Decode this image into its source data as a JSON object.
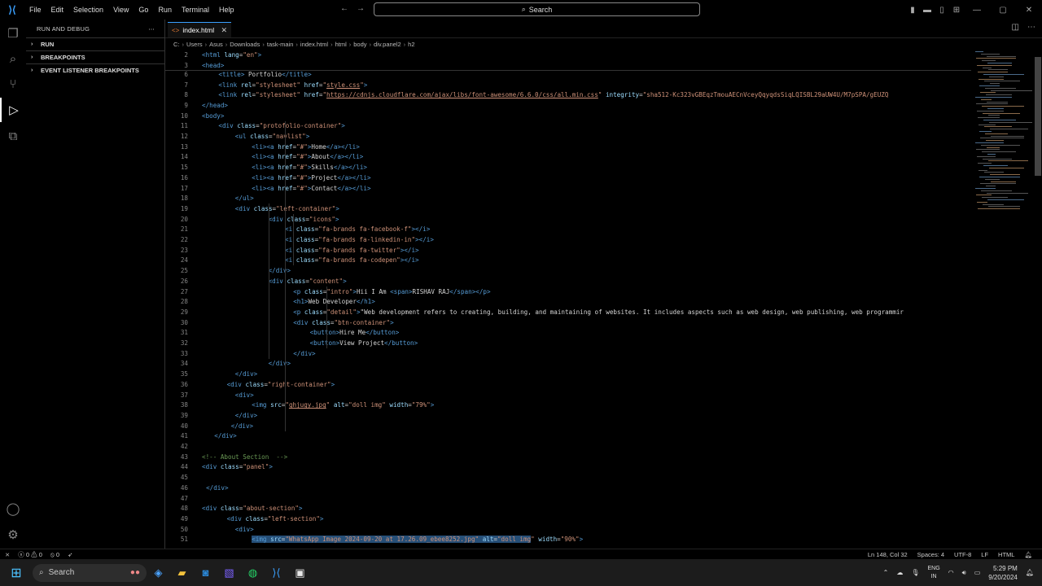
{
  "menu": [
    "File",
    "Edit",
    "Selection",
    "View",
    "Go",
    "Run",
    "Terminal",
    "Help"
  ],
  "command_center": {
    "label": "Search"
  },
  "tab": {
    "filename": "index.html"
  },
  "sidebar": {
    "title": "RUN AND DEBUG",
    "sections": [
      "RUN",
      "BREAKPOINTS",
      "EVENT LISTENER BREAKPOINTS"
    ]
  },
  "breadcrumb": [
    "C:",
    "Users",
    "Asus",
    "Downloads",
    "task-main",
    "index.html",
    "html",
    "body",
    "div.panel2",
    "h2"
  ],
  "sticky_lines": [
    {
      "n": "2",
      "html": "<span class='tag'>&lt;html</span> <span class='attr'>lang</span>=<span class='str'>\"en\"</span><span class='tag'>&gt;</span>"
    },
    {
      "n": "3",
      "html": "<span class='tag'>&lt;head&gt;</span>"
    }
  ],
  "code_lines": [
    {
      "n": "6",
      "i": 1,
      "html": "<span class='tag'>&lt;title&gt;</span> Portfolio<span class='tag'>&lt;/title&gt;</span>"
    },
    {
      "n": "7",
      "i": 1,
      "html": "<span class='tag'>&lt;link</span> <span class='attr'>rel</span>=<span class='str'>\"stylesheet\"</span> <span class='attr'>href</span>=<span class='str'>\"<u>style.css</u>\"</span><span class='tag'>&gt;</span>"
    },
    {
      "n": "8",
      "i": 1,
      "html": "<span class='tag'>&lt;link</span> <span class='attr'>rel</span>=<span class='str'>\"stylesheet\"</span> <span class='attr'>href</span>=<span class='str'>\"<u>https://cdnjs.cloudflare.com/ajax/libs/font-awesome/6.6.0/css/all.min.css</u>\"</span> <span class='attr'>integrity</span>=<span class='str'>\"sha512-Kc323vGBEqzTmouAECnVceyQqyqdsSiqLQISBL29aUW4U/M7pSPA/gEUZQ</span>"
    },
    {
      "n": "9",
      "i": 0,
      "html": "<span class='tag'>&lt;/head&gt;</span>"
    },
    {
      "n": "10",
      "i": 0,
      "html": "<span class='tag'>&lt;body&gt;</span>"
    },
    {
      "n": "11",
      "i": 1,
      "html": "<span class='tag'>&lt;div</span> <span class='attr'>class</span>=<span class='str'>\"protofolio-container\"</span><span class='tag'>&gt;</span>"
    },
    {
      "n": "12",
      "i": 2,
      "html": "<span class='tag'>&lt;ul</span> <span class='attr'>class</span>=<span class='str'>\"navlist\"</span><span class='tag'>&gt;</span>"
    },
    {
      "n": "13",
      "i": 3,
      "html": "<span class='tag'>&lt;li&gt;&lt;a</span> <span class='attr'>href</span>=<span class='str'>\"#\"</span><span class='tag'>&gt;</span>Home<span class='tag'>&lt;/a&gt;&lt;/li&gt;</span>"
    },
    {
      "n": "14",
      "i": 3,
      "html": "<span class='tag'>&lt;li&gt;&lt;a</span> <span class='attr'>href</span>=<span class='str'>\"#\"</span><span class='tag'>&gt;</span>About<span class='tag'>&lt;/a&gt;&lt;/li&gt;</span>"
    },
    {
      "n": "15",
      "i": 3,
      "html": "<span class='tag'>&lt;li&gt;&lt;a</span> <span class='attr'>href</span>=<span class='str'>\"#\"</span><span class='tag'>&gt;</span>Skills<span class='tag'>&lt;/a&gt;&lt;/li&gt;</span>"
    },
    {
      "n": "16",
      "i": 3,
      "html": "<span class='tag'>&lt;li&gt;&lt;a</span> <span class='attr'>href</span>=<span class='str'>\"#\"</span><span class='tag'>&gt;</span>Project<span class='tag'>&lt;/a&gt;&lt;/li&gt;</span>"
    },
    {
      "n": "17",
      "i": 3,
      "html": "<span class='tag'>&lt;li&gt;&lt;a</span> <span class='attr'>href</span>=<span class='str'>\"#\"</span><span class='tag'>&gt;</span>Contact<span class='tag'>&lt;/a&gt;&lt;/li&gt;</span>"
    },
    {
      "n": "18",
      "i": 2,
      "html": "<span class='tag'>&lt;/ul&gt;</span>"
    },
    {
      "n": "19",
      "i": 2,
      "html": "<span class='tag'>&lt;div</span> <span class='attr'>class</span>=<span class='str'>\"left-container\"</span><span class='tag'>&gt;</span>"
    },
    {
      "n": "20",
      "i": 4,
      "html": "<span class='tag'>&lt;div</span> <span class='attr'>class</span>=<span class='str'>\"icons\"</span><span class='tag'>&gt;</span>"
    },
    {
      "n": "21",
      "i": 5,
      "html": "<span class='tag'>&lt;i</span> <span class='attr'>class</span>=<span class='str'>\"fa-brands fa-facebook-f\"</span><span class='tag'>&gt;&lt;/i&gt;</span>"
    },
    {
      "n": "22",
      "i": 5,
      "html": "<span class='tag'>&lt;i</span> <span class='attr'>class</span>=<span class='str'>\"fa-brands fa-linkedin-in\"</span><span class='tag'>&gt;&lt;/i&gt;</span>"
    },
    {
      "n": "23",
      "i": 5,
      "html": "<span class='tag'>&lt;i</span> <span class='attr'>class</span>=<span class='str'>\"fa-brands fa-twitter\"</span><span class='tag'>&gt;&lt;/i&gt;</span>"
    },
    {
      "n": "24",
      "i": 5,
      "html": "<span class='tag'>&lt;i</span> <span class='attr'>class</span>=<span class='str'>\"fa-brands fa-codepen\"</span><span class='tag'>&gt;&lt;/i&gt;</span>"
    },
    {
      "n": "25",
      "i": 4,
      "html": "<span class='tag'>&lt;/div&gt;</span>"
    },
    {
      "n": "26",
      "i": 4,
      "html": "<span class='tag'>&lt;div</span> <span class='attr'>class</span>=<span class='str'>\"content\"</span><span class='tag'>&gt;</span>"
    },
    {
      "n": "27",
      "i": 5.5,
      "html": "<span class='tag'>&lt;p</span> <span class='attr'>class</span>=<span class='str'>\"intro\"</span><span class='tag'>&gt;</span>Hii I Am <span class='tag'>&lt;span&gt;</span>RISHAV RAJ<span class='tag'>&lt;/span&gt;&lt;/p&gt;</span>"
    },
    {
      "n": "28",
      "i": 5.5,
      "html": "<span class='tag'>&lt;h1&gt;</span>Web Developer<span class='tag'>&lt;/h1&gt;</span>"
    },
    {
      "n": "29",
      "i": 5.5,
      "html": "<span class='tag'>&lt;p</span> <span class='attr'>class</span>=<span class='str'>\"detail\"</span><span class='tag'>&gt;</span>\"Web development refers to creating, building, and maintaining of websites. It includes aspects such as web design, web publishing, web programmir"
    },
    {
      "n": "30",
      "i": 5.5,
      "html": "<span class='tag'>&lt;div</span> <span class='attr'>class</span>=<span class='str'>\"btn-container\"</span><span class='tag'>&gt;</span>"
    },
    {
      "n": "31",
      "i": 6.5,
      "html": "<span class='tag'>&lt;button&gt;</span>Hire Me<span class='tag'>&lt;/button&gt;</span>"
    },
    {
      "n": "32",
      "i": 6.5,
      "html": "<span class='tag'>&lt;button&gt;</span>View Project<span class='tag'>&lt;/button&gt;</span>"
    },
    {
      "n": "33",
      "i": 5.5,
      "html": "<span class='tag'>&lt;/div&gt;</span>"
    },
    {
      "n": "34",
      "i": 4,
      "html": "<span class='tag'>&lt;/div&gt;</span>"
    },
    {
      "n": "35",
      "i": 2,
      "html": "<span class='tag'>&lt;/div&gt;</span>"
    },
    {
      "n": "36",
      "i": 1.5,
      "html": "<span class='tag'>&lt;div</span> <span class='attr'>class</span>=<span class='str'>\"right-container\"</span><span class='tag'>&gt;</span>"
    },
    {
      "n": "37",
      "i": 2,
      "html": "<span class='tag'>&lt;div&gt;</span>"
    },
    {
      "n": "38",
      "i": 3,
      "html": "<span class='tag'>&lt;img</span> <span class='attr'>src</span>=<span class='str'>\"<u>ghjugy.jpg</u>\"</span> <span class='attr'>alt</span>=<span class='str'>\"doll img\"</span> <span class='attr'>width</span>=<span class='str'>\"79%\"</span><span class='tag'>&gt;</span>"
    },
    {
      "n": "39",
      "i": 2,
      "html": "<span class='tag'>&lt;/div&gt;</span>"
    },
    {
      "n": "40",
      "i": 1.75,
      "html": "<span class='tag'>&lt;/div&gt;</span>"
    },
    {
      "n": "41",
      "i": 0.75,
      "html": "<span class='tag'>&lt;/div&gt;</span>"
    },
    {
      "n": "42",
      "i": 0,
      "html": ""
    },
    {
      "n": "43",
      "i": 0,
      "html": "<span class='cmt'>&lt;!-- About Section  --&gt;</span>"
    },
    {
      "n": "44",
      "i": 0,
      "html": "<span class='tag'>&lt;div</span> <span class='attr'>class</span>=<span class='str'>\"panel\"</span><span class='tag'>&gt;</span>"
    },
    {
      "n": "45",
      "i": 0,
      "html": ""
    },
    {
      "n": "46",
      "i": 0.25,
      "html": "<span class='tag'>&lt;/div&gt;</span>"
    },
    {
      "n": "47",
      "i": 0,
      "html": ""
    },
    {
      "n": "48",
      "i": 0,
      "html": "<span class='tag'>&lt;div</span> <span class='attr'>class</span>=<span class='str'>\"about-section\"</span><span class='tag'>&gt;</span>"
    },
    {
      "n": "49",
      "i": 1.5,
      "html": "<span class='tag'>&lt;div</span> <span class='attr'>class</span>=<span class='str'>\"left-section\"</span><span class='tag'>&gt;</span>"
    },
    {
      "n": "50",
      "i": 2,
      "html": "<span class='tag'>&lt;div&gt;</span>"
    },
    {
      "n": "51",
      "i": 3,
      "sel": true,
      "html": "<span class='selected-line'><span class='tag'>&lt;img</span> <span class='attr'>src</span>=<span class='str'>\"WhatsApp Image 2024-09-20 at 17.26.09_ebee8252.jpg\"</span> <span class='attr'>alt</span>=<span class='str'>\"doll img</span></span><span class='str'>\"</span> <span class='attr'>width</span>=<span class='str'>\"90%\"</span><span class='tag'>&gt;</span>"
    }
  ],
  "status": {
    "errors": "0",
    "warnings": "0",
    "ports": "0",
    "position": "Ln 148, Col 32",
    "spaces": "Spaces: 4",
    "encoding": "UTF-8",
    "eol": "LF",
    "language": "HTML"
  },
  "taskbar": {
    "search": "Search",
    "lang_top": "ENG",
    "lang_bottom": "IN",
    "time": "5:29 PM",
    "date": "9/20/2024"
  }
}
